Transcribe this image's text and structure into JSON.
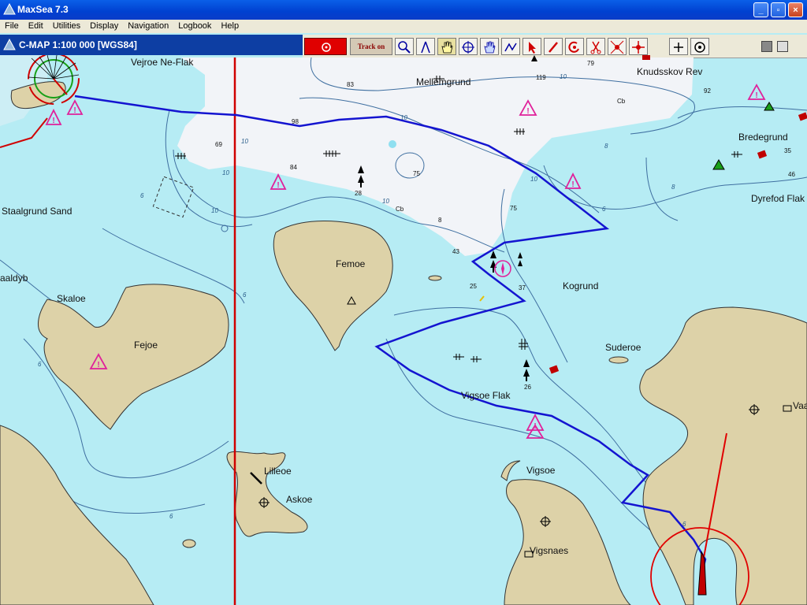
{
  "window": {
    "title": "MaxSea 7.3"
  },
  "menu": [
    "File",
    "Edit",
    "Utilities",
    "Display",
    "Navigation",
    "Logbook",
    "Help"
  ],
  "chart": {
    "title": "C-MAP  1:100 000 [WGS84]"
  },
  "toolbar": {
    "track_label": "Track on"
  },
  "icons": [
    "mob-icon",
    "track-toggle",
    "zoom-icon",
    "compass-divider-icon",
    "pan-hand-icon",
    "center-crosshair-icon",
    "grab-icon",
    "route-icon",
    "pointer-icon",
    "pencil-icon",
    "mark-icon",
    "scissors-icon",
    "waypoint-icon",
    "move-icon",
    "plus-icon",
    "target-icon"
  ],
  "places": [
    {
      "name": "Vejroe Ne-Flak"
    },
    {
      "name": "Mellemgrund"
    },
    {
      "name": "Knudsskov Rev"
    },
    {
      "name": "Bredegrund"
    },
    {
      "name": "Dyrefod Flak"
    },
    {
      "name": "Staalgrund Sand"
    },
    {
      "name": "Femoe"
    },
    {
      "name": "aaldyb"
    },
    {
      "name": "Skaloe"
    },
    {
      "name": "Fejoe"
    },
    {
      "name": "Kogrund"
    },
    {
      "name": "Suderoe"
    },
    {
      "name": "Vigsoe Flak"
    },
    {
      "name": "Vigsoe"
    },
    {
      "name": "Lilleoe"
    },
    {
      "name": "Askoe"
    },
    {
      "name": "Vigsnaes"
    },
    {
      "name": "Vaa"
    }
  ],
  "soundings": [
    "83",
    "119",
    "79",
    "92",
    "Cb",
    "98",
    "69",
    "84",
    "75",
    "28",
    "Cb",
    "8",
    "75",
    "43",
    "25",
    "37",
    "26",
    "35",
    "46",
    "10",
    "10",
    "10",
    "10",
    "10",
    "10",
    "6",
    "6",
    "6",
    "6",
    "6",
    "8",
    "8",
    "10",
    "6"
  ],
  "colors": {
    "sea": "#b6ecf4",
    "shoal": "#f2f4f8",
    "land": "#ddd2a8",
    "track": "#1414d0",
    "heading": "#e00000"
  }
}
